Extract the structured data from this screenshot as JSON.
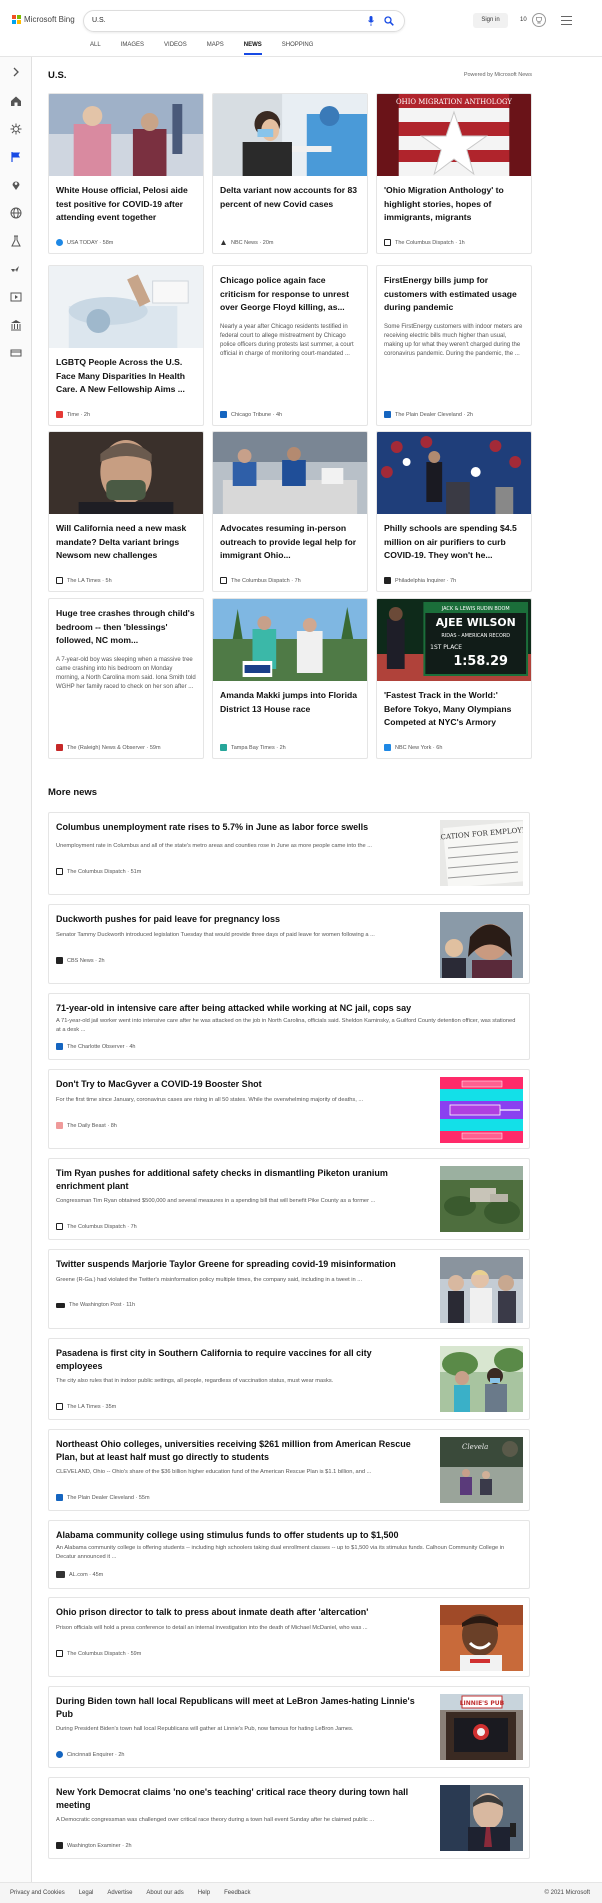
{
  "header": {
    "brand": "Microsoft Bing",
    "search_value": "U.S.",
    "signin_label": "Sign in",
    "rewards_count": "10",
    "nav": [
      "ALL",
      "IMAGES",
      "VIDEOS",
      "MAPS",
      "NEWS",
      "SHOPPING"
    ],
    "active_nav": "NEWS",
    "logo_colors": [
      "#f25022",
      "#7fba00",
      "#00a4ef",
      "#ffb900"
    ]
  },
  "main": {
    "section_title": "U.S.",
    "powered_by": "Powered by Microsoft News",
    "cards": [
      {
        "title": "White House official, Pelosi aide test positive for COVID-19 after attending event together",
        "snippet": "",
        "source": "USA TODAY · 58m",
        "img_colors": [
          "#b06a6a",
          "#e8c5c5"
        ],
        "icon_color": "#1e88e5"
      },
      {
        "title": "Delta variant now accounts for 83 percent of new Covid cases",
        "snippet": "",
        "source": "NBC News · 20m",
        "img_colors": [
          "#4a90c8",
          "#e6eef5"
        ],
        "icon_color": "#333333"
      },
      {
        "title": "'Ohio Migration Anthology' to highlight stories, hopes of immigrants, migrants",
        "snippet": "",
        "source": "The Columbus Dispatch · 1h",
        "img_colors": [
          "#c0272d",
          "#ffffff"
        ],
        "icon_color": "#222222"
      },
      {
        "title": "LGBTQ People Across the U.S. Face Many Disparities In Health Care. A New Fellowship Aims ...",
        "snippet": "",
        "source": "Time · 2h",
        "img_colors": [
          "#cfdce6",
          "#f2f5f7"
        ],
        "icon_color": "#e53935"
      },
      {
        "title": "Chicago police again face criticism for response to unrest over George Floyd killing, as...",
        "snippet": "Nearly a year after Chicago residents testified in federal court to allege mistreatment by Chicago police officers during protests last summer, a court official in charge of monitoring court-mandated ...",
        "source": "Chicago Tribune · 4h",
        "img_colors": [],
        "icon_color": "#1565c0"
      },
      {
        "title": "FirstEnergy bills jump for customers with estimated usage during pandemic",
        "snippet": "Some FirstEnergy customers with indoor meters are receiving electric bills much higher than usual, making up for what they weren't charged during the coronavirus pandemic. During the pandemic, the ...",
        "source": "The Plain Dealer Cleveland · 2h",
        "img_colors": [],
        "icon_color": "#1565c0"
      },
      {
        "title": "Will California need a new mask mandate? Delta variant brings Newsom new challenges",
        "snippet": "",
        "source": "The LA Times · 5h",
        "img_colors": [
          "#5a4a40",
          "#2a2522"
        ],
        "icon_color": "#222222"
      },
      {
        "title": "Advocates resuming in-person outreach to provide legal help for immigrant Ohio...",
        "snippet": "",
        "source": "The Columbus Dispatch · 7h",
        "img_colors": [
          "#2f5fa8",
          "#d9d9d9"
        ],
        "icon_color": "#222222"
      },
      {
        "title": "Philly schools are spending $4.5 million on air purifiers to curb COVID-19. They won't he...",
        "snippet": "",
        "source": "Philadelphia Inquirer · 7h",
        "img_colors": [
          "#1f3e7a",
          "#8a1f2a"
        ],
        "icon_color": "#222222"
      },
      {
        "title": "Huge tree crashes through child's bedroom -- then 'blessings' followed, NC mom...",
        "snippet": "A 7-year-old boy was sleeping when a massive tree came crashing into his bedroom on Monday morning, a North Carolina mom said. Iona Smith told WGHP her family raced to check on her son after ...",
        "source": "The (Raleigh) News & Observer · 59m",
        "img_colors": [],
        "icon_color": "#c62828"
      },
      {
        "title": "Amanda Makki jumps into Florida District 13 House race",
        "snippet": "",
        "source": "Tampa Bay Times · 2h",
        "img_colors": [
          "#6aa7d8",
          "#3f6d3a"
        ],
        "icon_color": "#26a69a"
      },
      {
        "title": "'Fastest Track in the World:' Before Tokyo, Many Olympians Competed at NYC's Armory",
        "snippet": "",
        "source": "NBC New York · 6h",
        "img_colors": [
          "#1b6e3a",
          "#0e2a1a"
        ],
        "icon_color": "#1e88e5"
      }
    ],
    "scoreboard": {
      "top": "JACK & LEWIS RUDIN BOOM",
      "name": "AJEE WILSON",
      "sub": "RIDAS - AMERICAN RECORD",
      "place": "1ST PLACE",
      "time": "1:58.29"
    },
    "migration_banner": "OHIO MIGRATION ANTHOLOGY"
  },
  "more_news": {
    "title": "More news",
    "items": [
      {
        "title": "Columbus unemployment rate rises to 5.7% in June as labor force swells",
        "snippet": "Unemployment rate in Columbus and all of the state's metro areas and counties rose in June as more people came into the ...",
        "source": "The Columbus Dispatch · 51m",
        "thumb": "form",
        "icon_color": "#222222"
      },
      {
        "title": "Duckworth pushes for paid leave for pregnancy loss",
        "snippet": "Senator Tammy Duckworth introduced legislation Tuesday that would provide three days of paid leave for women following a ...",
        "source": "CBS News · 2h",
        "thumb": "people",
        "icon_color": "#222222"
      },
      {
        "title": "71-year-old in intensive care after being attacked while working at NC jail, cops say",
        "snippet": "A 71-year-old jail worker went into intensive care after he was attacked on the job in North Carolina, officials said. Sheldon Kaminsky, a Guilford County detention officer, was stationed at a desk ...",
        "source": "The Charlotte Observer · 4h",
        "thumb": "",
        "icon_color": "#1565c0"
      },
      {
        "title": "Don't Try to MacGyver a COVID-19 Booster Shot",
        "snippet": "For the first time since January, coronavirus cases are rising in all 50 states. While the overwhelming majority of deaths, ...",
        "source": "The Daily Beast · 8h",
        "thumb": "syringe",
        "icon_color": "#ef9a9a"
      },
      {
        "title": "Tim Ryan pushes for additional safety checks in dismantling Piketon uranium enrichment plant",
        "snippet": "Congressman Tim Ryan obtained $500,000 and several measures in a spending bill that will benefit Pike County as a former ...",
        "source": "The Columbus Dispatch · 7h",
        "thumb": "aerial",
        "icon_color": "#222222"
      },
      {
        "title": "Twitter suspends Marjorie Taylor Greene for spreading covid-19 misinformation",
        "snippet": "Greene (R-Ga.) had violated the Twitter's misinformation policy multiple times, the company said, including in a tweet in ...",
        "source": "The Washington Post · 11h",
        "thumb": "crowd",
        "icon_color": "#222222"
      },
      {
        "title": "Pasadena is first city in Southern California to require vaccines for all city employees",
        "snippet": "The city also rules that in indoor public settings, all people, regardless of vaccination status, must wear masks.",
        "source": "The LA Times · 35m",
        "thumb": "outdoor",
        "icon_color": "#222222"
      },
      {
        "title": "Northeast Ohio colleges, universities receiving $261 million from American Rescue Plan, but at least half must go directly to students",
        "snippet": "CLEVELAND, Ohio -- Ohio's share of the $36 billion higher education fund of the American Rescue Plan is $1.1 billion, and ...",
        "source": "The Plain Dealer Cleveland · 55m",
        "thumb": "campus",
        "icon_color": "#1565c0"
      },
      {
        "title": "Alabama community college using stimulus funds to offer students up to $1,500",
        "snippet": "An Alabama community college is offering students -- including high schoolers taking dual enrollment classes -- up to $1,500 via its stimulus funds. Calhoun Community College in Decatur announced it ...",
        "source": "AL.com · 45m",
        "thumb": "",
        "icon_color": "#333333"
      },
      {
        "title": "Ohio prison director to talk to press about inmate death after 'altercation'",
        "snippet": "Prison officials will hold a press conference to detail an internal investigation into the death of Michael McDaniel, who was ...",
        "source": "The Columbus Dispatch · 59m",
        "thumb": "portrait",
        "icon_color": "#222222"
      },
      {
        "title": "During Biden town hall local Republicans will meet at LeBron James-hating Linnie's Pub",
        "snippet": "During President Biden's town hall local Republicans will gather at Linnie's Pub, now famous for hating LeBron James.",
        "source": "Cincinnati Enquirer · 2h",
        "thumb": "pub",
        "icon_color": "#1565c0"
      },
      {
        "title": "New York Democrat claims 'no one's teaching' critical race theory during town hall meeting",
        "snippet": "A Democratic congressman was challenged over critical race theory during a town hall event Sunday after he claimed public ...",
        "source": "Washington Examiner · 2h",
        "thumb": "speaker",
        "icon_color": "#222222"
      }
    ],
    "form_text": "APPLICATION FOR EMPLOYMENT",
    "pub_sign": "LINNIE'S PUB"
  },
  "footer": {
    "links": [
      "Privacy and Cookies",
      "Legal",
      "Advertise",
      "About our ads",
      "Help",
      "Feedback"
    ],
    "copyright": "© 2021 Microsoft"
  }
}
